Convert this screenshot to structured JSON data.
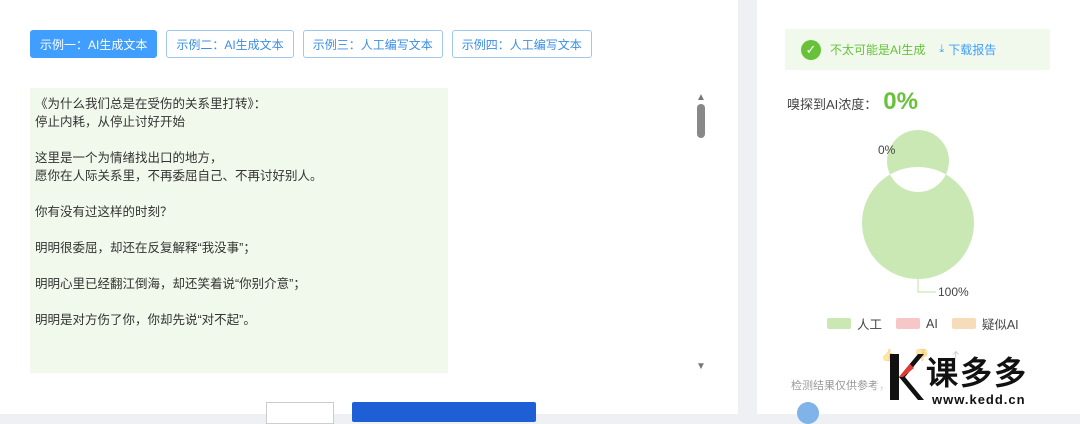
{
  "tabs": [
    {
      "label": "示例一：AI生成文本",
      "active": true
    },
    {
      "label": "示例二：AI生成文本",
      "active": false
    },
    {
      "label": "示例三：人工编写文本",
      "active": false
    },
    {
      "label": "示例四：人工编写文本",
      "active": false
    }
  ],
  "text_lines": [
    {
      "text": "《为什么我们总是在受伤的关系里打转》：",
      "gap": false
    },
    {
      "text": "停止内耗，从停止讨好开始",
      "gap": false
    },
    {
      "text": "这里是一个为情绪找出口的地方，",
      "gap": true
    },
    {
      "text": "愿你在人际关系里，不再委屈自己、不再讨好别人。",
      "gap": false
    },
    {
      "text": "你有没有过这样的时刻？",
      "gap": true
    },
    {
      "text": "明明很委屈，却还在反复解释“我没事”；",
      "gap": true
    },
    {
      "text": "明明心里已经翻江倒海，却还笑着说“你别介意”；",
      "gap": true
    },
    {
      "text": "明明是对方伤了你，你却先说“对不起”。",
      "gap": true
    }
  ],
  "result": {
    "verdict": "不太可能是AI生成",
    "download_label": "下载报告",
    "concentration_label": "嗅探到AI浓度：",
    "concentration_value": "0%"
  },
  "colors": {
    "human": "#c9e8b4",
    "ai": "#f7c6c7",
    "suspected_ai": "#f7dcb9",
    "accent": "#409eff",
    "success": "#67c23a"
  },
  "chart_data": {
    "type": "pie",
    "categories": [
      "人工",
      "AI",
      "疑似AI"
    ],
    "values": [
      100,
      0,
      0
    ],
    "labels": [
      "100%",
      "0%"
    ],
    "legend": "bottom"
  },
  "legend": [
    {
      "label": "人工"
    },
    {
      "label": "AI"
    },
    {
      "label": "疑似AI"
    }
  ],
  "disclaimer": "检测结果仅供参考，",
  "watermark": {
    "brand": "课多多",
    "url": "www.kedd.cn"
  }
}
